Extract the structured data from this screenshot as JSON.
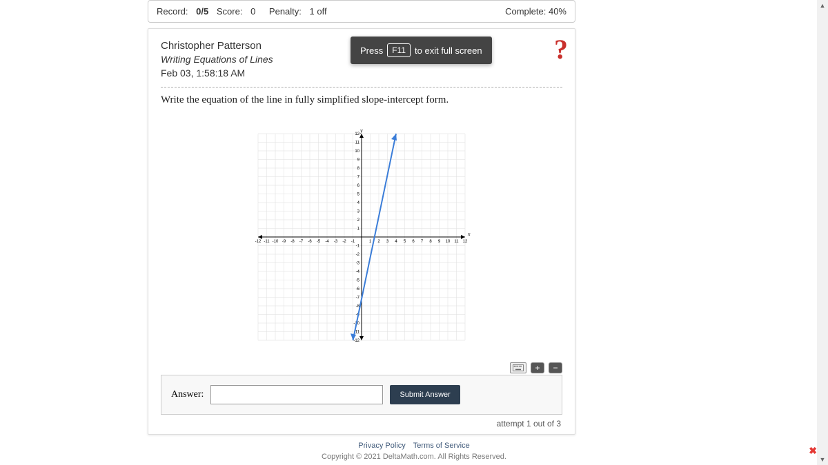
{
  "top_bar": {
    "record_label": "Record:",
    "record_value": "0/5",
    "score_label": "Score:",
    "score_value": "0",
    "penalty_label": "Penalty:",
    "penalty_value": "1 off",
    "complete_label": "Complete:",
    "complete_value": "40%"
  },
  "header": {
    "student_name": "Christopher Patterson",
    "assignment": "Writing Equations of Lines",
    "timestamp": "Feb 03, 1:58:18 AM"
  },
  "help_icon": "?",
  "question": "Write the equation of the line in fully simplified slope-intercept form.",
  "chart_data": {
    "type": "line",
    "x_range": [
      -12,
      12
    ],
    "y_range": [
      -12,
      12
    ],
    "x_label": "x",
    "y_label": "y",
    "line_points": [
      [
        -1,
        -12
      ],
      [
        4,
        12
      ]
    ],
    "slope": 4.8,
    "passes_through": [
      1.5,
      0
    ]
  },
  "answer": {
    "label": "Answer:",
    "value": "",
    "placeholder": "",
    "submit_label": "Submit Answer",
    "attempt_text": "attempt 1 out of 3"
  },
  "fullscreen": {
    "press": "Press",
    "key": "F11",
    "rest": "to exit full screen"
  },
  "footer": {
    "privacy": "Privacy Policy",
    "terms": "Terms of Service",
    "copyright": "Copyright © 2021 DeltaMath.com. All Rights Reserved."
  },
  "tools": {
    "plus": "+",
    "minus": "−"
  }
}
